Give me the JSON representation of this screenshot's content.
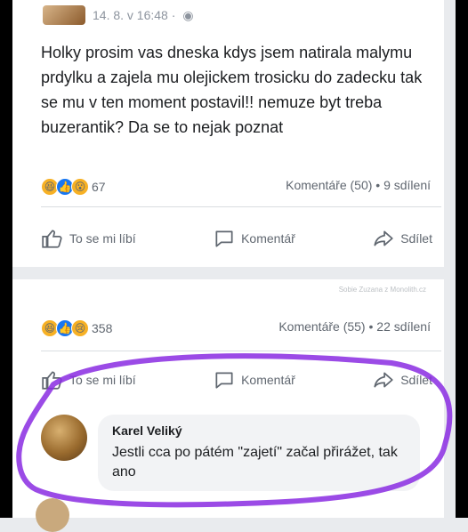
{
  "post1": {
    "timestamp": "14. 8. v 16:48 ·",
    "text": "Holky prosim vas dneska kdys jsem natirala malymu prdylku a zajela mu olejickem trosicku do zadecku tak se mu v ten moment postavil!! nemuze byt treba buzerantik? Da se to nejak poznat",
    "reaction_count": "67",
    "comments_share": "Komentáře (50) • 9 sdílení",
    "actions": {
      "like": "To se mi líbí",
      "comment": "Komentář",
      "share": "Sdílet"
    }
  },
  "post2": {
    "watermark": "Sobie Zuzana z Monolith.cz",
    "reaction_count": "358",
    "comments_share": "Komentáře (55) • 22 sdílení",
    "actions": {
      "like": "To se mi líbí",
      "comment": "Komentář",
      "share": "Sdílet"
    },
    "comment": {
      "author": "Karel Veliký",
      "text": "Jestli cca po pátém \"zajetí\" začal přirážet, tak ano"
    }
  },
  "icons": [
    "globe-icon",
    "haha-reaction-icon",
    "like-reaction-icon",
    "wow-reaction-icon",
    "sad-reaction-icon",
    "thumbs-up-icon",
    "comment-icon",
    "share-icon"
  ],
  "colors": {
    "like_blue": "#1877f2",
    "reaction_yellow": "#f7b125",
    "annotation_purple": "#8a2be2"
  }
}
